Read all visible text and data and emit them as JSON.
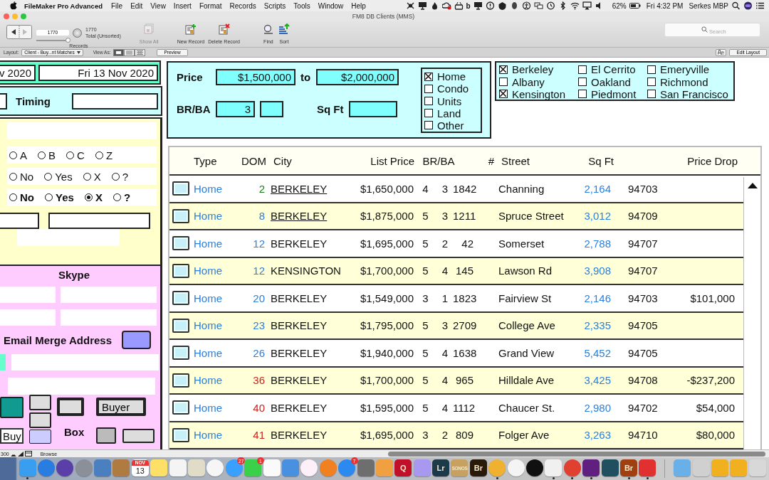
{
  "menu_bar": {
    "app_name": "FileMaker Pro Advanced",
    "menus": [
      "File",
      "Edit",
      "View",
      "Insert",
      "Format",
      "Records",
      "Scripts",
      "Tools",
      "Window",
      "Help"
    ],
    "status_glyph": "b",
    "battery": "62%",
    "clock": "Fri 4:32 PM",
    "user": "Serkes MBP"
  },
  "window": {
    "title": "FM8 DB Clients (MMS)"
  },
  "toolbar": {
    "record_field": "1770",
    "slider": {
      "level": 0.95
    },
    "records_label": "Records",
    "record_count": "1770",
    "record_status": "Total (Unsorted)",
    "buttons": [
      {
        "kind": "show_all",
        "label": "Show All",
        "disabled": true
      },
      {
        "kind": "new",
        "label": "New Record",
        "disabled": false
      },
      {
        "kind": "delete",
        "label": "Delete Record",
        "disabled": false
      },
      {
        "kind": "find",
        "label": "Find",
        "disabled": false
      },
      {
        "kind": "sort",
        "label": "Sort",
        "disabled": false
      }
    ],
    "search": {
      "placeholder": "Search"
    }
  },
  "layout_bar": {
    "layout_label": "Layout:",
    "layout_value": "Client - Buy...nt Matches",
    "view_as_label": "View As:",
    "view_modes": [
      {
        "kind": "form",
        "selected": true
      },
      {
        "kind": "list",
        "selected": false
      },
      {
        "kind": "table",
        "selected": false
      }
    ],
    "preview": "Preview",
    "edit_layout": "Edit Layout"
  },
  "left_panel": {
    "date_start": "v 2020",
    "date_end": "Fri 13 Nov 2020",
    "timing_label": "Timing",
    "radio_groups": [
      {
        "bold": false,
        "options": [
          {
            "label": "A",
            "selected": false
          },
          {
            "label": "B",
            "selected": false
          },
          {
            "label": "C",
            "selected": false
          },
          {
            "label": "Z",
            "selected": false
          }
        ]
      },
      {
        "bold": false,
        "options": [
          {
            "label": "No",
            "selected": false
          },
          {
            "label": "Yes",
            "selected": false
          },
          {
            "label": "X",
            "selected": false
          },
          {
            "label": "?",
            "selected": false
          }
        ]
      },
      {
        "bold": true,
        "options": [
          {
            "label": "No",
            "selected": false
          },
          {
            "label": "Yes",
            "selected": false
          },
          {
            "label": "X",
            "selected": true
          },
          {
            "label": "?",
            "selected": false
          }
        ]
      }
    ],
    "skype_label": "Skype",
    "email_merge_label": "Email Merge Address",
    "buyer_button": "Buyer",
    "buy_field": "Buy",
    "box_label": "Box"
  },
  "filters": {
    "price_label": "Price",
    "price_min": "$1,500,000",
    "to_label": "to",
    "price_max": "$2,000,000",
    "brba_label": "BR/BA",
    "br_value": "3",
    "sqft_label": "Sq Ft",
    "types": [
      {
        "label": "Home",
        "checked": true
      },
      {
        "label": "Condo",
        "checked": false
      },
      {
        "label": "Units",
        "checked": false
      },
      {
        "label": "Land",
        "checked": false
      },
      {
        "label": "Other",
        "checked": false
      }
    ]
  },
  "cities": [
    {
      "label": "Berkeley",
      "checked": true
    },
    {
      "label": "El Cerrito",
      "checked": false
    },
    {
      "label": "Emeryville",
      "checked": false
    },
    {
      "label": "Albany",
      "checked": false
    },
    {
      "label": "Oakland",
      "checked": false
    },
    {
      "label": "Richmond",
      "checked": false
    },
    {
      "label": "Kensington",
      "checked": true
    },
    {
      "label": "Piedmont",
      "checked": false
    },
    {
      "label": "San Francisco",
      "checked": false
    }
  ],
  "table": {
    "columns": [
      "Type",
      "DOM",
      "City",
      "List Price",
      "BR/BA",
      "#",
      "Street",
      "Sq Ft",
      "Price Drop"
    ],
    "rows": [
      {
        "type": "Home",
        "dom": "2",
        "color": "#1f7a1f",
        "city": "BERKELEY",
        "link": true,
        "price": "$1,650,000",
        "br": "4",
        "ba": "3",
        "number": "1842",
        "street": "Channing",
        "sqft": "2,164",
        "zip": "94703"
      },
      {
        "type": "Home",
        "dom": "8",
        "color": "#2a7fe0",
        "city": "BERKELEY",
        "link": true,
        "price": "$1,875,000",
        "br": "5",
        "ba": "3",
        "number": "1211",
        "street": "Spruce Street",
        "sqft": "3,012",
        "zip": "94709"
      },
      {
        "type": "Home",
        "dom": "12",
        "color": "#2a7fe0",
        "city": "BERKELEY",
        "link": false,
        "price": "$1,695,000",
        "br": "5",
        "ba": "2",
        "number": "42",
        "street": "Somerset",
        "sqft": "2,788",
        "zip": "94707"
      },
      {
        "type": "Home",
        "dom": "12",
        "color": "#2a7fe0",
        "city": "KENSINGTON",
        "link": false,
        "price": "$1,700,000",
        "br": "5",
        "ba": "4",
        "number": "145",
        "street": "Lawson Rd",
        "sqft": "3,908",
        "zip": "94707"
      },
      {
        "type": "Home",
        "dom": "20",
        "color": "#2a7fe0",
        "city": "BERKELEY",
        "link": false,
        "price": "$1,549,000",
        "br": "3",
        "ba": "1",
        "number": "1823",
        "street": "Fairview St",
        "sqft": "2,146",
        "zip": "94703",
        "price_drop": "$101,000"
      },
      {
        "type": "Home",
        "dom": "23",
        "color": "#2a7fe0",
        "city": "BERKELEY",
        "link": false,
        "price": "$1,795,000",
        "br": "5",
        "ba": "3",
        "number": "2709",
        "street": "College Ave",
        "sqft": "2,335",
        "zip": "94705"
      },
      {
        "type": "Home",
        "dom": "26",
        "color": "#2a7fe0",
        "city": "BERKELEY",
        "link": false,
        "price": "$1,940,000",
        "br": "5",
        "ba": "4",
        "number": "1638",
        "street": "Grand View",
        "sqft": "5,452",
        "zip": "94705"
      },
      {
        "type": "Home",
        "dom": "36",
        "color": "#cc2222",
        "city": "BERKELEY",
        "link": false,
        "price": "$1,700,000",
        "br": "5",
        "ba": "4",
        "number": "965",
        "street": "Hilldale Ave",
        "sqft": "3,425",
        "zip": "94708",
        "price_drop": "-$237,200"
      },
      {
        "type": "Home",
        "dom": "40",
        "color": "#cc2222",
        "city": "BERKELEY",
        "link": false,
        "price": "$1,595,000",
        "br": "5",
        "ba": "4",
        "number": "1112",
        "street": "Chaucer St.",
        "sqft": "2,980",
        "zip": "94702",
        "price_drop": "$54,000"
      },
      {
        "type": "Home",
        "dom": "41",
        "color": "#cc2222",
        "city": "BERKELEY",
        "link": false,
        "price": "$1,695,000",
        "br": "3",
        "ba": "2",
        "number": "809",
        "street": "Folger Ave",
        "sqft": "3,263",
        "zip": "94710",
        "price_drop": "$80,000"
      }
    ]
  },
  "status_bar": {
    "zoom": "300",
    "mode": "Browse"
  },
  "dock": [
    {
      "kind": "square",
      "color": "#3a9ef0",
      "running": true
    },
    {
      "kind": "circle",
      "color": "#2a7de0",
      "running": false
    },
    {
      "kind": "circle",
      "color": "#5a3fa8",
      "running": false
    },
    {
      "kind": "circle",
      "color": "#8a8f98",
      "running": false
    },
    {
      "kind": "square",
      "color": "#4a7fc0",
      "running": false
    },
    {
      "kind": "square",
      "color": "#b07b40",
      "running": false
    },
    {
      "kind": "calendar",
      "color": "#ffffff",
      "month": "NOV",
      "day": "13",
      "running": false
    },
    {
      "kind": "square",
      "color": "#ffe066",
      "running": false
    },
    {
      "kind": "square",
      "color": "#f4f4f4",
      "running": false
    },
    {
      "kind": "square",
      "color": "#e0dcc8",
      "running": false
    },
    {
      "kind": "circle",
      "color": "#f6f6f6",
      "running": false
    },
    {
      "kind": "circle",
      "color": "#3aa0ff",
      "badge": "27",
      "running": false
    },
    {
      "kind": "square",
      "color": "#3ad04a",
      "badge": "1",
      "running": false
    },
    {
      "kind": "square",
      "color": "#fafafa",
      "running": false
    },
    {
      "kind": "square",
      "color": "#4a90e0",
      "running": false
    },
    {
      "kind": "circle",
      "color": "#fdf0f8",
      "running": false
    },
    {
      "kind": "circle",
      "color": "#f08020",
      "running": false
    },
    {
      "kind": "circle",
      "color": "#2a8af0",
      "badge": "7",
      "running": false
    },
    {
      "kind": "square",
      "color": "#6e6e6e",
      "running": false
    },
    {
      "kind": "square",
      "color": "#f0a040",
      "running": false
    },
    {
      "kind": "square",
      "color": "#c0102a",
      "label": "Q",
      "running": false
    },
    {
      "kind": "square",
      "color": "#a898f0",
      "running": false
    },
    {
      "kind": "square",
      "color": "#1c3a4a",
      "label": "Lr",
      "running": false
    },
    {
      "kind": "square",
      "color": "#c8a060",
      "label": "SONOS",
      "running": false
    },
    {
      "kind": "square",
      "color": "#2a1a0a",
      "label": "Br",
      "running": false
    },
    {
      "kind": "circle",
      "color": "#f0b030",
      "running": true
    },
    {
      "kind": "circle",
      "color": "#f4f4f4",
      "running": false
    },
    {
      "kind": "circle",
      "color": "#101010",
      "running": false
    },
    {
      "kind": "square",
      "color": "#f0f0f0",
      "running": true
    },
    {
      "kind": "circle",
      "color": "#e04030",
      "running": true
    },
    {
      "kind": "square",
      "color": "#602080",
      "running": true
    },
    {
      "kind": "square",
      "color": "#205060",
      "running": false
    },
    {
      "kind": "square",
      "color": "#a04010",
      "label": "Br",
      "running": true
    },
    {
      "kind": "square",
      "color": "#e03030",
      "running": true
    },
    {
      "kind": "separator"
    },
    {
      "kind": "square",
      "color": "#6ab0e8",
      "running": false
    },
    {
      "kind": "square",
      "color": "#d0d0d0",
      "running": false
    },
    {
      "kind": "square",
      "color": "#f0b020",
      "running": false
    },
    {
      "kind": "square",
      "color": "#f0b020",
      "running": false
    },
    {
      "kind": "square",
      "color": "#d8d8d8",
      "running": false
    }
  ]
}
